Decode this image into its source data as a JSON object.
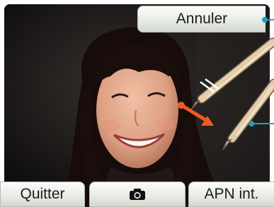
{
  "toolbar": {
    "cancel_label": "Annuler",
    "quit_label": "Quitter",
    "switch_camera_label": "APN int."
  },
  "icons": {
    "shutter": "camera-icon",
    "stylus": "stylus-icon",
    "drag_arrow": "arrow-icon",
    "callout": "callout-marker"
  },
  "colors": {
    "accent": "#1aa3c8",
    "arrow": "#ee5a24",
    "button_text": "#1a1a1a"
  }
}
